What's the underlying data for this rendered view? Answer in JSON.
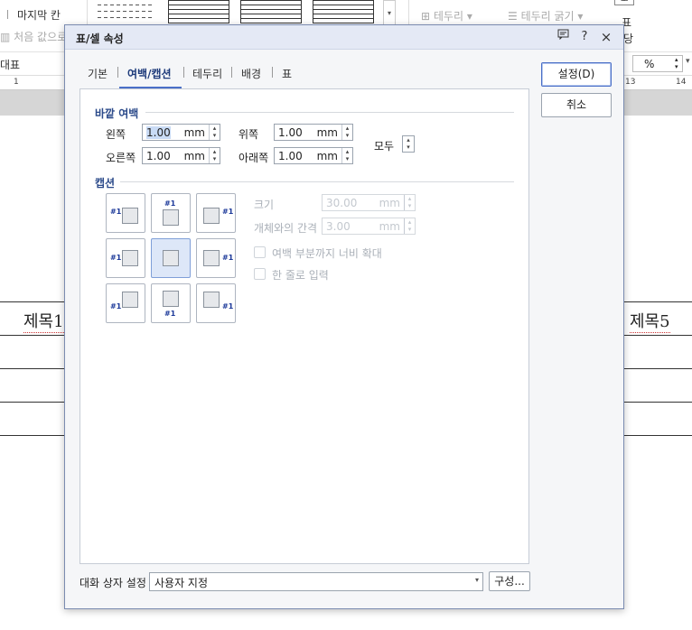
{
  "background": {
    "ribbon": {
      "last_column": "마지막 칸",
      "reset_to_default": "처음 값으로",
      "border": "테두리",
      "border_thickness": "테두리 굵기",
      "table_partial_1": "표",
      "table_partial_2": "당"
    },
    "style_box": "대표",
    "percent_field": "%",
    "ruler_numbers": [
      "1",
      "13",
      "14"
    ],
    "doc_titles": [
      "제목1",
      "제목5"
    ]
  },
  "dialog": {
    "title": "표/셀 속성",
    "help_label": "?",
    "close_label": "×",
    "tabs": [
      {
        "label": "기본"
      },
      {
        "label": "여백/캡션"
      },
      {
        "label": "테두리"
      },
      {
        "label": "배경"
      },
      {
        "label": "표"
      }
    ],
    "active_tab": "여백/캡션",
    "outer_margin": {
      "section_label": "바깥 여백",
      "left_label": "왼쪽",
      "left_value": "1.00",
      "right_label": "오른쪽",
      "right_value": "1.00",
      "top_label": "위쪽",
      "top_value": "1.00",
      "bottom_label": "아래쪽",
      "bottom_value": "1.00",
      "unit": "mm",
      "all_label": "모두"
    },
    "caption": {
      "section_label": "캡션",
      "marker": "#1",
      "selected_position": "center",
      "size_label": "크기",
      "size_value": "30.00",
      "gap_label": "개체와의 간격",
      "gap_value": "3.00",
      "unit": "mm",
      "extend_width_label": "여백 부분까지 너비 확대",
      "single_line_label": "한 줄로 입력"
    },
    "buttons": {
      "ok": "설정(D)",
      "cancel": "취소",
      "configure": "구성..."
    },
    "dialog_settings": {
      "label": "대화 상자 설정",
      "value": "사용자 지정"
    }
  }
}
